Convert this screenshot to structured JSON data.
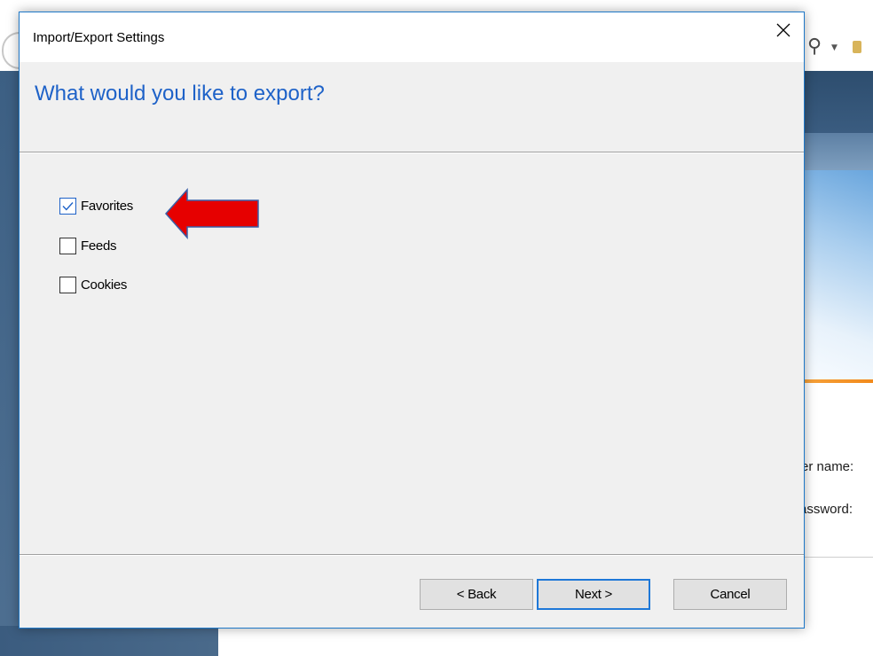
{
  "background": {
    "labels": [
      "er name:",
      "assword:"
    ]
  },
  "dialog": {
    "title": "Import/Export Settings",
    "heading": "What would you like to export?",
    "options": [
      {
        "label": "Favorites",
        "checked": true
      },
      {
        "label": "Feeds",
        "checked": false
      },
      {
        "label": "Cookies",
        "checked": false
      }
    ],
    "buttons": {
      "back": "< Back",
      "next": "Next >",
      "cancel": "Cancel"
    },
    "annotation": {
      "color": "#e60000",
      "points_to": "Favorites"
    }
  },
  "colors": {
    "accent": "#1e62c8",
    "border": "#1e78c8"
  }
}
